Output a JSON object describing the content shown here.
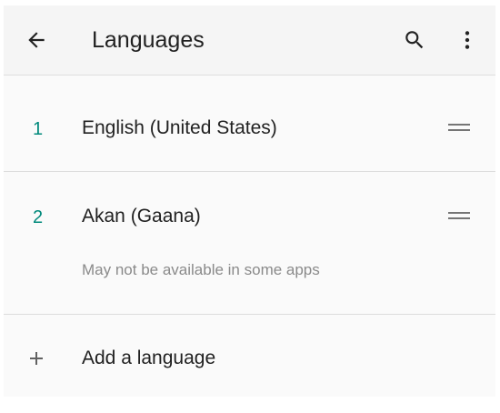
{
  "header": {
    "title": "Languages",
    "back_icon": "arrow-back-icon",
    "search_icon": "search-icon",
    "menu_icon": "more-vertical-icon"
  },
  "languages": [
    {
      "number": "1",
      "name": "English (United States)",
      "subtext": ""
    },
    {
      "number": "2",
      "name": "Akan (Gaana)",
      "subtext": "May not be available in some apps"
    }
  ],
  "add_language": {
    "label": "Add a language",
    "icon": "plus-icon"
  },
  "colors": {
    "accent": "#00897b",
    "text_primary": "#212121",
    "text_secondary": "#8a8a8a",
    "background": "#fafafa"
  }
}
